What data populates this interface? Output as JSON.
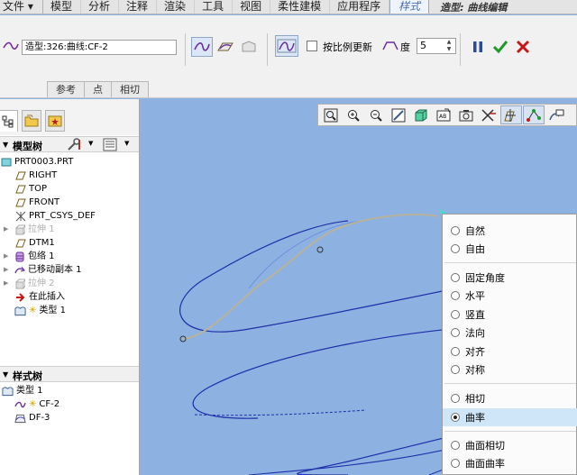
{
  "menubar": {
    "items": [
      "文件",
      "模型",
      "分析",
      "注释",
      "渲染",
      "工具",
      "视图",
      "柔性建模",
      "应用程序"
    ],
    "active_tab": "样式",
    "title": "造型: 曲线编辑"
  },
  "ribbon": {
    "curve_name": "造型:326:曲线:CF-2",
    "proportional_update_label": "按比例更新",
    "degree_label": "度",
    "degree_value": "5",
    "tabs": [
      "参考",
      "点",
      "相切"
    ]
  },
  "model_tree": {
    "header": "模型树",
    "items": [
      {
        "label": "PRT0003.PRT",
        "dim": false
      },
      {
        "label": "RIGHT",
        "dim": false
      },
      {
        "label": "TOP",
        "dim": false
      },
      {
        "label": "FRONT",
        "dim": false
      },
      {
        "label": "PRT_CSYS_DEF",
        "dim": false
      },
      {
        "label": "拉伸 1",
        "dim": true
      },
      {
        "label": "DTM1",
        "dim": false
      },
      {
        "label": "包络 1",
        "dim": false
      },
      {
        "label": "已移动副本 1",
        "dim": false
      },
      {
        "label": "拉伸 2",
        "dim": true
      },
      {
        "label": "在此插入",
        "dim": false
      },
      {
        "label": "类型 1",
        "dim": false
      }
    ]
  },
  "style_tree": {
    "header": "样式树",
    "items": [
      "类型 1",
      "CF-2",
      "DF-3"
    ]
  },
  "context_menu": {
    "groups": [
      [
        "自然",
        "自由"
      ],
      [
        "固定角度",
        "水平",
        "竖直",
        "法向",
        "对齐",
        "对称"
      ],
      [
        "相切",
        "曲率"
      ],
      [
        "曲面相切",
        "曲面曲率"
      ]
    ],
    "selected": "曲率"
  },
  "colors": {
    "viewport_bg": "#8db2e2",
    "curve_blue": "#1f2fa8",
    "curve_gray": "#b7b29b",
    "menu_highlight": "#cfe6f8"
  }
}
